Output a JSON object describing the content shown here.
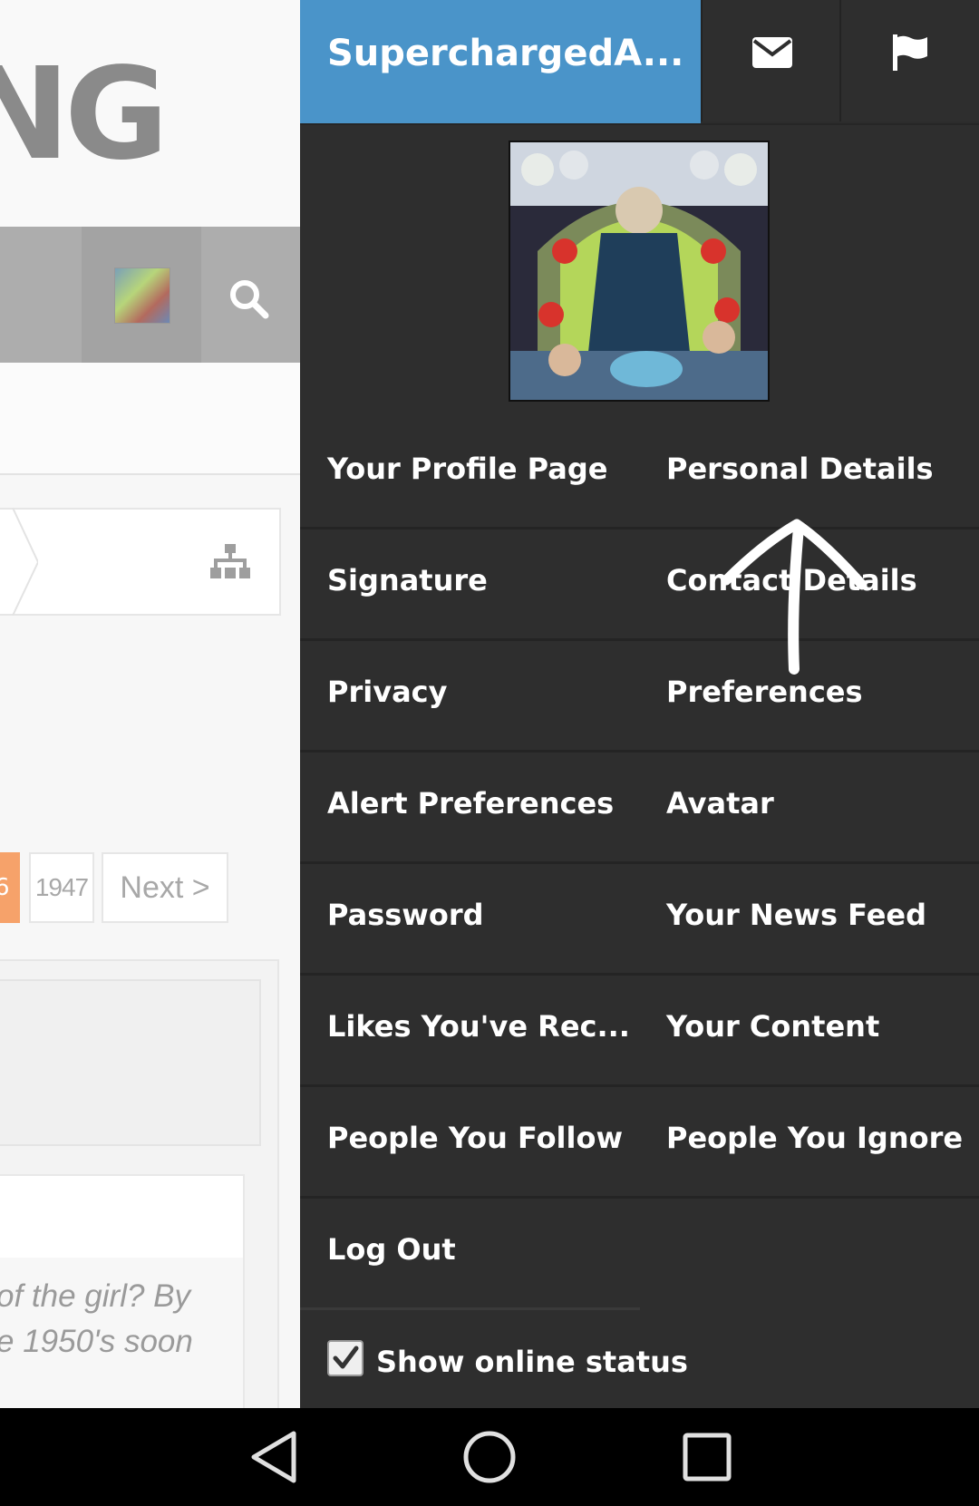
{
  "background_page": {
    "logo_fragment": "NG",
    "pagination": {
      "current_fragment": "6",
      "last_page": "1947",
      "next_label": "Next >"
    },
    "quote_lines": [
      "of the girl? By",
      "e 1950's soon"
    ]
  },
  "user_menu": {
    "username": "SuperchargedA...",
    "items": [
      {
        "left": "Your Profile Page",
        "right": "Personal Details"
      },
      {
        "left": "Signature",
        "right": "Contact Details"
      },
      {
        "left": "Privacy",
        "right": "Preferences"
      },
      {
        "left": "Alert Preferences",
        "right": "Avatar"
      },
      {
        "left": "Password",
        "right": "Your News Feed"
      },
      {
        "left": "Likes You've Rec...",
        "right": "Your Content"
      },
      {
        "left": "People You Follow",
        "right": "People You Ignore"
      }
    ],
    "logout_label": "Log Out",
    "online_status": {
      "label": "Show online status",
      "checked": true
    }
  },
  "icons": {
    "inbox": "envelope-icon",
    "alerts": "flag-icon",
    "search": "search-icon",
    "sitemap": "sitemap-icon",
    "back": "back-triangle-icon",
    "home": "home-circle-icon",
    "recents": "recents-square-icon"
  },
  "colors": {
    "username_bg": "#4a94c9",
    "panel_bg": "#2e2e2e",
    "pager_current": "#f6a26a"
  }
}
